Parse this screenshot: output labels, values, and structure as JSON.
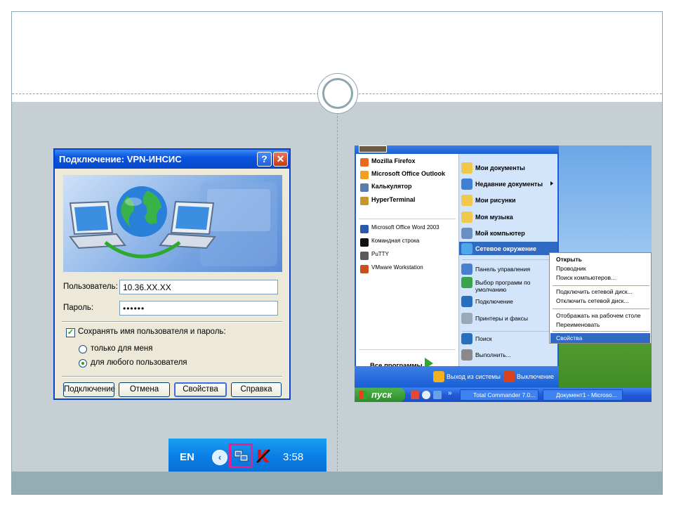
{
  "dialog": {
    "title": "Подключение: VPN-ИНСИС",
    "help_glyph": "?",
    "close_glyph": "✕",
    "user_label": "Пользователь:",
    "user_value": "10.36.XX.XX",
    "password_label": "Пароль:",
    "password_value": "••••••",
    "save_label": "Сохранять имя пользователя и пароль:",
    "save_checked": true,
    "radio_me": "только для меня",
    "radio_any": "для любого пользователя",
    "btn_connect": "Подключение",
    "btn_cancel": "Отмена",
    "btn_properties": "Свойства",
    "btn_help": "Справка"
  },
  "start_menu": {
    "left_pinned": [
      {
        "label": "Mozilla Firefox",
        "icon": "firefox-icon",
        "color": "#e66a1f"
      },
      {
        "label": "Microsoft Office Outlook",
        "icon": "outlook-icon",
        "color": "#f0a020"
      },
      {
        "label": "Калькулятор",
        "icon": "calculator-icon",
        "color": "#5a7bb0"
      },
      {
        "label": "HyperTerminal",
        "icon": "hyperterminal-icon",
        "color": "#c8962c"
      }
    ],
    "left_recent": [
      {
        "label": "Microsoft Office Word 2003",
        "icon": "word-icon",
        "color": "#2b5aa8"
      },
      {
        "label": "Командная строка",
        "icon": "cmd-icon",
        "color": "#111111"
      },
      {
        "label": "PuTTY",
        "icon": "putty-icon",
        "color": "#5a5a5a"
      },
      {
        "label": "VMware Workstation",
        "icon": "vmware-icon",
        "color": "#c8501e"
      }
    ],
    "all_programs": "Все программы",
    "right_items": [
      {
        "label": "Мои документы",
        "icon": "my-documents-icon",
        "color": "#f2c84a"
      },
      {
        "label": "Недавние документы",
        "icon": "recent-documents-icon",
        "color": "#3f7fd6"
      },
      {
        "label": "Мои рисунки",
        "icon": "my-pictures-icon",
        "color": "#f2c84a"
      },
      {
        "label": "Моя музыка",
        "icon": "my-music-icon",
        "color": "#f2c84a"
      },
      {
        "label": "Мой компьютер",
        "icon": "my-computer-icon",
        "color": "#6b8fc4"
      },
      {
        "label": "Сетевое окружение",
        "icon": "network-places-icon",
        "color": "#4fa6e8"
      }
    ],
    "right_items_2": [
      {
        "label": "Панель управления",
        "icon": "control-panel-icon",
        "color": "#4a7fd0"
      },
      {
        "label": "Выбор программ по умолчанию",
        "icon": "default-programs-icon",
        "color": "#3aa34a"
      },
      {
        "label": "Подключение",
        "icon": "connect-icon",
        "color": "#2a6ec0"
      },
      {
        "label": "Принтеры и факсы",
        "icon": "printers-icon",
        "color": "#9aa8b8"
      }
    ],
    "right_items_3": [
      {
        "label": "Поиск",
        "icon": "search-icon",
        "color": "#2a6ec0"
      },
      {
        "label": "Выполнить...",
        "icon": "run-icon",
        "color": "#8a8a8a"
      }
    ],
    "logoff": "Выход из системы",
    "shutdown": "Выключение"
  },
  "context_menu": {
    "open": "Открыть",
    "explorer": "Проводник",
    "search_computers": "Поиск компьютеров...",
    "map_drive": "Подключить сетевой диск...",
    "disconnect_drive": "Отключить сетевой диск...",
    "show_desktop": "Отображать на рабочем столе",
    "rename": "Переименовать",
    "properties": "Свойства"
  },
  "taskbar": {
    "start": "пуск",
    "chevron": "»",
    "task1": "Total Commander 7.0...",
    "task2": "Документ1 - Microso..."
  },
  "tray": {
    "lang": "EN",
    "arrow": "‹",
    "time": "3:58"
  }
}
